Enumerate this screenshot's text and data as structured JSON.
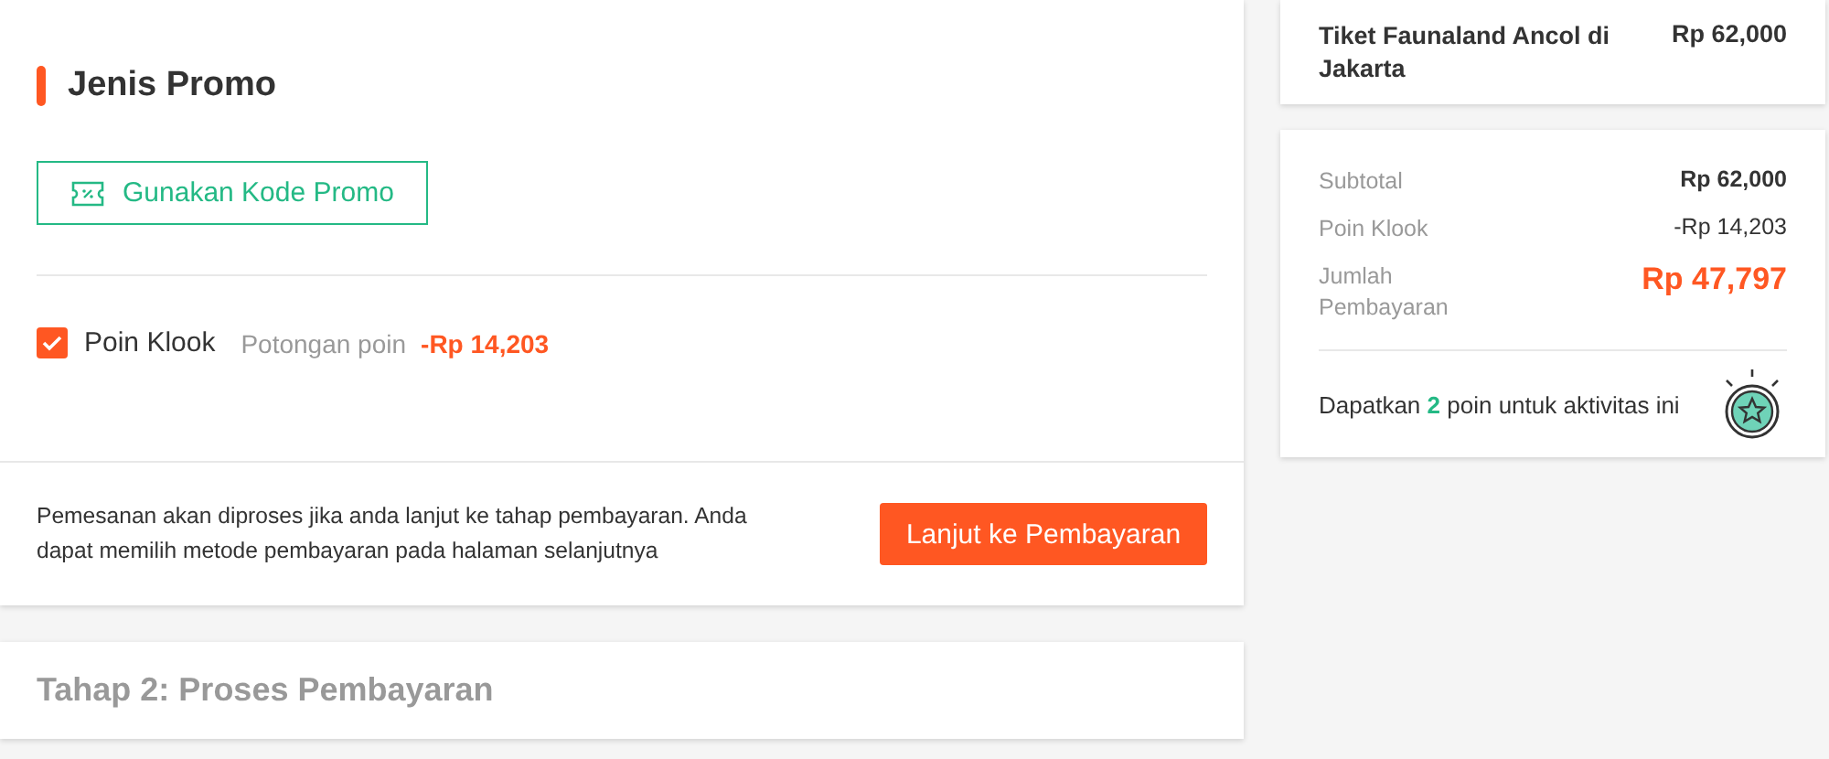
{
  "promo": {
    "title": "Jenis Promo",
    "code_button": "Gunakan Kode Promo",
    "points": {
      "checked": true,
      "label": "Poin Klook",
      "caption": "Potongan poin",
      "amount": "-Rp 14,203"
    }
  },
  "footer": {
    "note": "Pemesanan akan diproses jika anda lanjut ke tahap pembayaran. Anda dapat memilih metode pembayaran pada halaman selanjutnya",
    "button": "Lanjut ke Pembayaran"
  },
  "step2": {
    "title": "Tahap 2: Proses Pembayaran"
  },
  "order": {
    "item": "Tiket Faunaland Ancol di Jakarta",
    "price": "Rp 62,000"
  },
  "summary": {
    "rows": [
      {
        "kind": "subtotal",
        "label": "Subtotal",
        "value": "Rp 62,000"
      },
      {
        "kind": "discount",
        "label": "Poin Klook",
        "value": "-Rp 14,203"
      },
      {
        "kind": "total",
        "label": "Jumlah Pembayaran",
        "value": "Rp 47,797"
      }
    ],
    "earn": {
      "before": "Dapatkan",
      "points": "2",
      "after": "poin untuk aktivitas ini"
    }
  }
}
